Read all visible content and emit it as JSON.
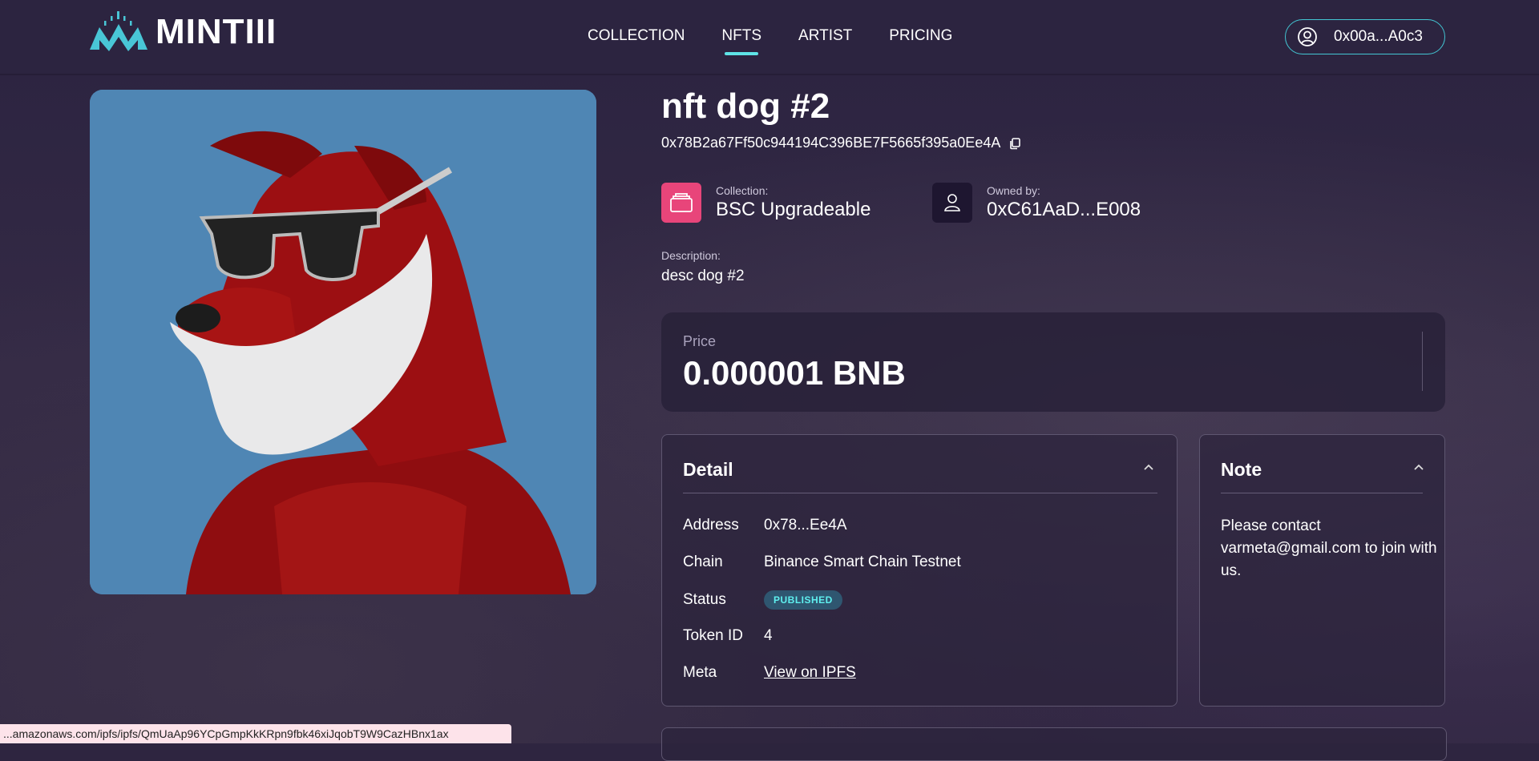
{
  "header": {
    "logo_text": "MINTIII",
    "nav": [
      {
        "label": "COLLECTION"
      },
      {
        "label": "NFTS"
      },
      {
        "label": "ARTIST"
      },
      {
        "label": "PRICING"
      }
    ],
    "wallet_label": "0x00a...A0c3"
  },
  "nft": {
    "title": "nft dog #2",
    "contract_address": "0x78B2a67Ff50c944194C396BE7F5665f395a0Ee4A",
    "collection_label": "Collection:",
    "collection_name": "BSC Upgradeable",
    "owner_label": "Owned by:",
    "owner_value": "0xC61AaD...E008",
    "description_label": "Description:",
    "description_value": "desc dog #2"
  },
  "price": {
    "label": "Price",
    "value": "0.000001 BNB"
  },
  "detail": {
    "title": "Detail",
    "rows": [
      {
        "key": "Address",
        "value": "0x78...Ee4A"
      },
      {
        "key": "Chain",
        "value": "Binance Smart Chain Testnet"
      },
      {
        "key": "Status",
        "value": "PUBLISHED"
      },
      {
        "key": "Token ID",
        "value": "4"
      },
      {
        "key": "Meta",
        "value": "View on IPFS"
      }
    ]
  },
  "note": {
    "title": "Note",
    "text": "Please contact varmeta@gmail.com to join with us."
  },
  "status_bar": {
    "url": "...amazonaws.com/ipfs/ipfs/QmUaAp96YCpGmpKkKRpn9fbk46xiJqobT9W9CazHBnx1ax"
  },
  "colors": {
    "accent": "#5fe3e6",
    "collection_icon_bg": "#e8457a",
    "owner_icon_bg": "#1e1630",
    "badge_bg": "#2f5670"
  },
  "icons": {
    "logo": "logo-icon",
    "wallet": "user-circle-icon",
    "copy": "copy-icon",
    "collection": "folder-icon",
    "owner": "user-icon",
    "chevron": "chevron-up-icon"
  }
}
